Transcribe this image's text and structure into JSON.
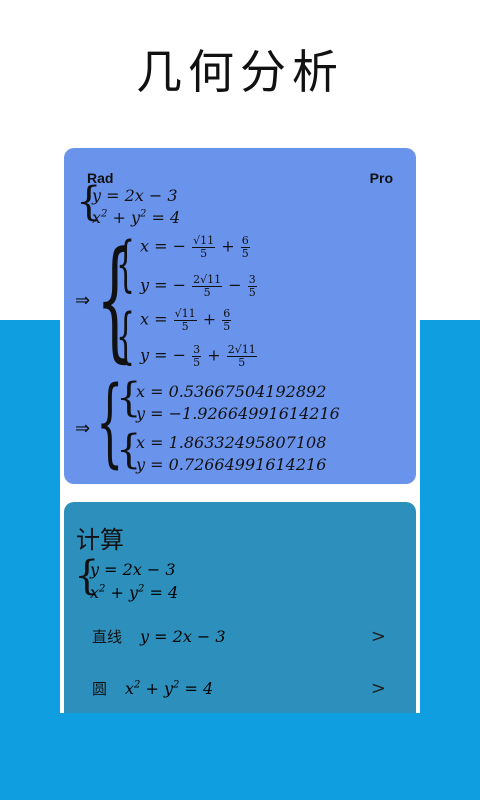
{
  "hero": {
    "title": "几何分析"
  },
  "top_card": {
    "mode_label": "Rad",
    "pro_label": "Pro",
    "system": {
      "line1": "y = 2x − 3",
      "line2_base": "x",
      "line2_plus": "+ y",
      "line2_end": "= 4",
      "exp": "2"
    },
    "arrow": "⇒",
    "exact": {
      "s1": {
        "x_prefix": "x = −",
        "x_num": "√11",
        "x_den": "5",
        "x_plus": "+",
        "x_num2": "6",
        "x_den2": "5",
        "y_prefix": "y = −",
        "y_num": "2√11",
        "y_den": "5",
        "y_minus": "−",
        "y_num2": "3",
        "y_den2": "5"
      },
      "s2": {
        "x_prefix": "x =",
        "x_num": "√11",
        "x_den": "5",
        "x_plus": "+",
        "x_num2": "6",
        "x_den2": "5",
        "y_prefix": "y = −",
        "y_num": "3",
        "y_den": "5",
        "y_plus": "+",
        "y_num2": "2√11",
        "y_den2": "5"
      }
    },
    "decimal": {
      "s1": {
        "x": "x = 0.53667504192892",
        "y": "y = −1.92664991614216"
      },
      "s2": {
        "x": "x = 1.86332495807108",
        "y": "y = 0.72664991614216"
      }
    }
  },
  "bottom_card": {
    "title": "计算",
    "system": {
      "line1": "y = 2x − 3",
      "line2_base": "x",
      "line2_plus": "+ y",
      "line2_end": "= 4",
      "exp": "2"
    },
    "items": [
      {
        "label": "直线",
        "equation": "y = 2x − 3",
        "chevron": ">"
      },
      {
        "label": "圆",
        "eq_base": "x",
        "eq_plus": "+ y",
        "eq_end": "= 4",
        "exp": "2",
        "chevron": ">"
      }
    ]
  },
  "colors": {
    "background_band": "#0f9ee0",
    "top_card": "#6a93ec",
    "bottom_card": "#2d8fbc"
  }
}
